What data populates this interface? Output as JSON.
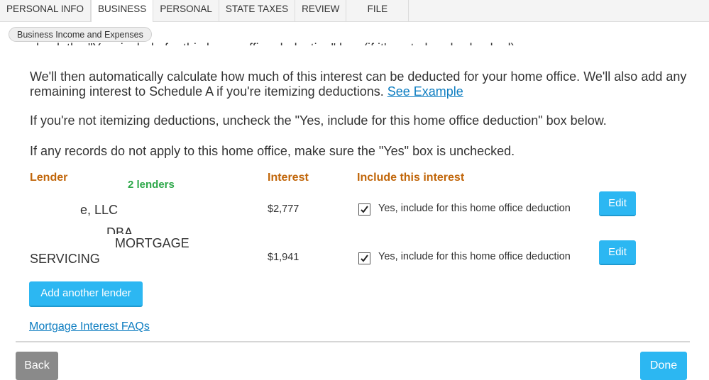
{
  "tabs": [
    "PERSONAL INFO",
    "BUSINESS",
    "PERSONAL",
    "STATE TAXES",
    "REVIEW",
    "FILE"
  ],
  "active_tab": "BUSINESS",
  "breadcrumb": "Business Income and Expenses",
  "content": {
    "cutoff_line": "check the \"Yes, include for this home office deduction\" box (if it's not already checked).",
    "para1": "We'll then automatically calculate how much of this interest can be deducted for your home office. We'll also add any remaining interest to Schedule A if you're itemizing deductions.",
    "para1_link": "See Example",
    "para2": "If you're not itemizing deductions, uncheck the \"Yes, include for this home office deduction\" box below.",
    "para3": "If any records do not apply to this home office, make sure the \"Yes\" box is unchecked."
  },
  "table": {
    "headers": {
      "lender": "Lender",
      "interest": "Interest",
      "include": "Include this interest"
    },
    "note": "2 lenders",
    "rows": [
      {
        "lender_lines": [
          "e, LLC"
        ],
        "interest": "$2,777",
        "include_label": "Yes, include for this home office deduction",
        "checked": true,
        "edit_label": "Edit"
      },
      {
        "lender_lines": [
          "DBA",
          "MORTGAGE",
          "SERVICING"
        ],
        "interest": "$1,941",
        "include_label": "Yes, include for this home office deduction",
        "checked": true,
        "edit_label": "Edit"
      }
    ]
  },
  "add_lender_label": "Add another lender",
  "faq_link": "Mortgage Interest FAQs",
  "back_label": "Back",
  "done_label": "Done",
  "colors": {
    "accent": "#2cb7f2",
    "header_orange": "#c1660a",
    "note_green": "#2ea84a",
    "link": "#0d7dc1"
  }
}
